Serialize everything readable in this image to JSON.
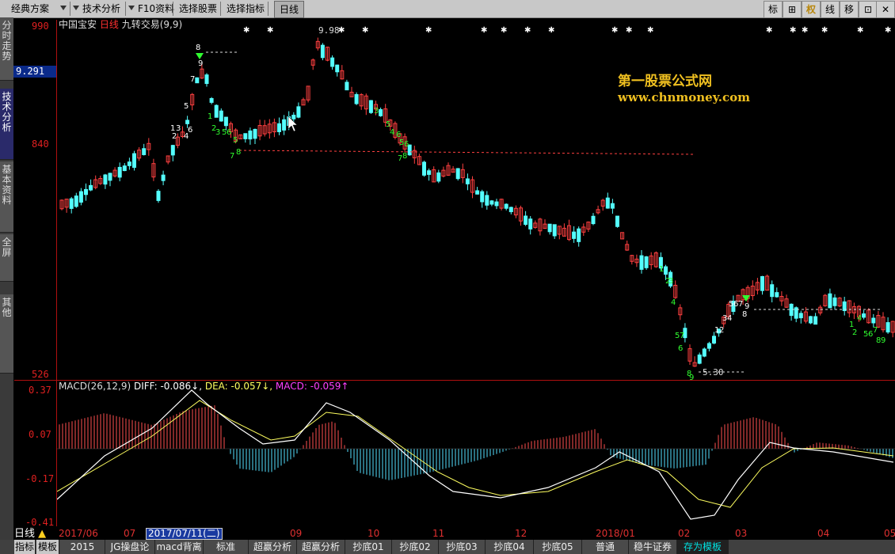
{
  "top_menu": {
    "items": [
      {
        "label": "经典方案",
        "dropdown": true
      },
      {
        "label": "技术分析",
        "dropdown": true
      },
      {
        "label": "F10资料",
        "dropdown": true
      },
      {
        "label": "选择股票",
        "dropdown": false
      },
      {
        "label": "选择指标",
        "dropdown": false
      }
    ],
    "active_tab": "日线",
    "right_buttons": [
      "标",
      "⊞",
      "权",
      "线",
      "移",
      "⊡",
      "✕"
    ]
  },
  "left_tabs": [
    "分时走势",
    "技术分析",
    "基本资料",
    "全屏",
    "其他"
  ],
  "main_chart": {
    "stock_name": "中国宝安",
    "period": "日线",
    "indicator": "九转交易(9,9)",
    "y_labels": [
      "990",
      "840",
      "526"
    ],
    "current_price": "9.291",
    "peak_label": "9.98",
    "low_label": "5.30",
    "watermark_title": "第一股票公式网",
    "watermark_url": "www.chnmoney.com",
    "colors": {
      "up": "#ff4040",
      "down": "#54ffff",
      "axis": "#b01010",
      "count_up": "#ffffff",
      "count_down": "#30ff30"
    }
  },
  "macd_chart": {
    "name": "MACD(26,12,9)",
    "diff_label": "DIFF: -0.086↓,",
    "dea_label": "DEA: -0.057↓,",
    "macd_label": "MACD: -0.059↑",
    "y_labels": [
      "0.37",
      "0.07",
      "-0.17",
      "-0.41"
    ]
  },
  "date_axis": {
    "labels": [
      "2017/06",
      "07",
      "09",
      "10",
      "11",
      "12",
      "2018/01",
      "02",
      "03",
      "04",
      "05"
    ],
    "selected_date": "2017/07/11(二)"
  },
  "bottom_bar": {
    "left_labels": [
      "指标",
      "模板"
    ],
    "period_label": "日线",
    "tabs": [
      "2015",
      "JG操盘论",
      "macd背离",
      "标准",
      "超赢分析",
      "超赢分析",
      "抄底01",
      "抄底02",
      "抄底03",
      "抄底04",
      "抄底05",
      "普通",
      "稳牛证券",
      "存为模板"
    ],
    "active_tab": "存为模板"
  }
}
